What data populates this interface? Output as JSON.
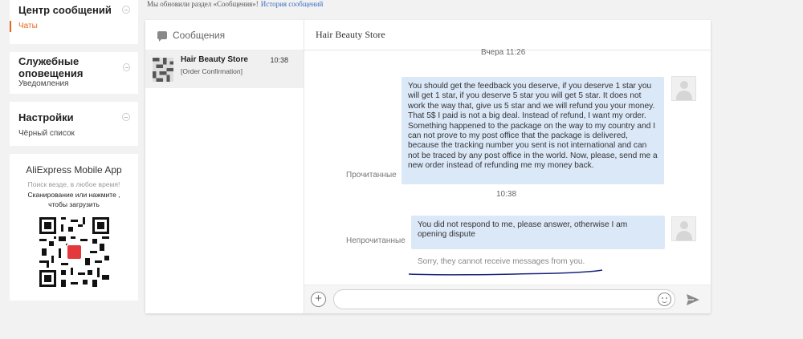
{
  "sidebar": {
    "sections": [
      {
        "title": "Центр сообщений",
        "item": "Чаты"
      },
      {
        "title": "Служебные оповещения",
        "item": "Уведомления"
      },
      {
        "title": "Настройки",
        "item": "Чёрный список"
      }
    ],
    "app": {
      "title": "AliExpress Mobile App",
      "search_note": "Поиск везде, в любое время!",
      "scan_line1": "Сканирование или нажмите ,",
      "scan_line2": "чтобы загрузить"
    }
  },
  "notice": {
    "text": "Мы обновили раздел «Сообщения»!",
    "link": "История сообщений"
  },
  "conversations": {
    "header": "Сообщения",
    "items": [
      {
        "name": "Hair Beauty Store",
        "time": "10:38",
        "preview": "[Order Confirmation]"
      }
    ]
  },
  "chat": {
    "title": "Hair Beauty Store",
    "messages": [
      {
        "timestamp": "Вчера 11:26",
        "status": "Прочитанные",
        "text": "You should get the feedback you deserve, if you deserve 1 star you will get 1 star, if you deserve 5 star you will get 5 star. It does not work the way that, give us 5 star and we will refund you your money. That 5$ I paid is not a big deal. Instead of refund, I want my order. Something happened to the package on the way to my country and I can not prove to my post office that the package is delivered, because the tracking number you sent is not international and can not be traced by any post office in the world. Now, please, send me a new order instead of refunding me my money back."
      },
      {
        "timestamp": "10:38",
        "status": "Непрочитанные",
        "text": "You did not respond to me, please answer, otherwise I am opening dispute",
        "error": "Sorry, they cannot receive messages from you."
      }
    ],
    "input": {
      "value": "",
      "placeholder": ""
    },
    "add_label": "+"
  },
  "colors": {
    "accent": "#e76a1c",
    "bubble": "#dbe8f8",
    "link": "#3a6cc3",
    "annotation_ink": "#1a237e"
  },
  "icons": [
    "collapse-icon",
    "message-icon",
    "avatar",
    "add-icon",
    "emoji-icon",
    "send-icon",
    "qr-code"
  ]
}
